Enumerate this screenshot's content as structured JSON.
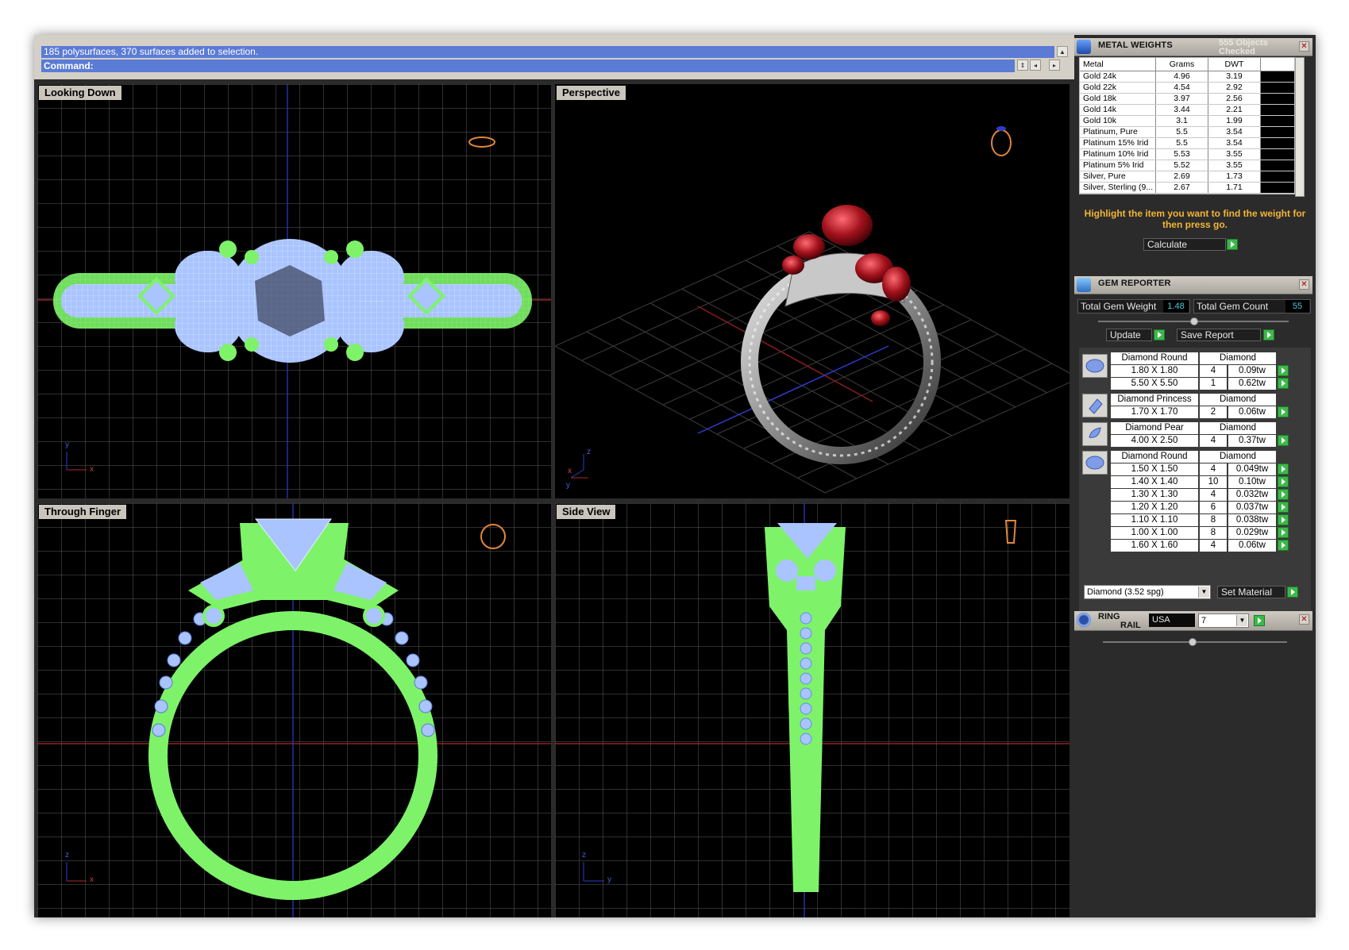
{
  "command": {
    "history": "185 polysurfaces, 370 surfaces added to selection.",
    "prompt": "Command:"
  },
  "viewports": {
    "top_left": "Looking Down",
    "top_right": "Perspective",
    "bottom_left": "Through Finger",
    "bottom_right": "Side View"
  },
  "metal_weights": {
    "title": "METAL WEIGHTS",
    "objects_checked": "555 Objects Checked",
    "headers": [
      "Metal",
      "Grams",
      "DWT"
    ],
    "rows": [
      [
        "Gold 24k",
        "4.96",
        "3.19"
      ],
      [
        "Gold 22k",
        "4.54",
        "2.92"
      ],
      [
        "Gold 18k",
        "3.97",
        "2.56"
      ],
      [
        "Gold 14k",
        "3.44",
        "2.21"
      ],
      [
        "Gold 10k",
        "3.1",
        "1.99"
      ],
      [
        "Platinum, Pure",
        "5.5",
        "3.54"
      ],
      [
        "Platinum 15% Irid",
        "5.5",
        "3.54"
      ],
      [
        "Platinum 10% Irid",
        "5.53",
        "3.55"
      ],
      [
        "Platinum 5% Irid",
        "5.52",
        "3.55"
      ],
      [
        "Silver, Pure",
        "2.69",
        "1.73"
      ],
      [
        "Silver, Sterling (9...",
        "2.67",
        "1.71"
      ]
    ],
    "hint": "Highlight the item you want to find the weight for then press go.",
    "calculate_label": "Calculate"
  },
  "gem_reporter": {
    "title": "GEM REPORTER",
    "total_weight_label": "Total Gem Weight",
    "total_weight": "1.48",
    "total_count_label": "Total Gem Count",
    "total_count": "55",
    "update_label": "Update",
    "save_label": "Save Report",
    "groups": [
      {
        "name": "Diamond Round",
        "material": "Diamond",
        "shape": "round",
        "rows": [
          [
            "1.80 X 1.80",
            "4",
            "0.09tw"
          ],
          [
            "5.50 X 5.50",
            "1",
            "0.62tw"
          ]
        ]
      },
      {
        "name": "Diamond Princess",
        "material": "Diamond",
        "shape": "princess",
        "rows": [
          [
            "1.70 X 1.70",
            "2",
            "0.06tw"
          ]
        ]
      },
      {
        "name": "Diamond Pear",
        "material": "Diamond",
        "shape": "pear",
        "rows": [
          [
            "4.00 X 2.50",
            "4",
            "0.37tw"
          ]
        ]
      },
      {
        "name": "Diamond Round",
        "material": "Diamond",
        "shape": "round",
        "rows": [
          [
            "1.50 X 1.50",
            "4",
            "0.049tw"
          ],
          [
            "1.40 X 1.40",
            "10",
            "0.10tw"
          ],
          [
            "1.30 X 1.30",
            "4",
            "0.032tw"
          ],
          [
            "1.20 X 1.20",
            "6",
            "0.037tw"
          ],
          [
            "1.10 X 1.10",
            "8",
            "0.038tw"
          ],
          [
            "1.00 X 1.00",
            "8",
            "0.029tw"
          ],
          [
            "1.60 X 1.60",
            "4",
            "0.06tw"
          ]
        ]
      }
    ],
    "material_select": "Diamond     (3.52 spg)",
    "set_material_label": "Set Material"
  },
  "ring_rail": {
    "title_line1": "RING",
    "title_line2": "RAIL",
    "region": "USA",
    "size": "7"
  },
  "axes": {
    "top_left": [
      "y",
      "x"
    ],
    "top_right": [
      "z",
      "x",
      "y"
    ],
    "bottom_left": [
      "z",
      "x"
    ],
    "bottom_right": [
      "z",
      "y"
    ]
  },
  "colors": {
    "accent_select": "#5b7bd5",
    "wire_green": "#7ef36a",
    "wire_blue": "#a9c4ff",
    "ruby": "#a3121c",
    "hint_orange": "#f3b534"
  }
}
